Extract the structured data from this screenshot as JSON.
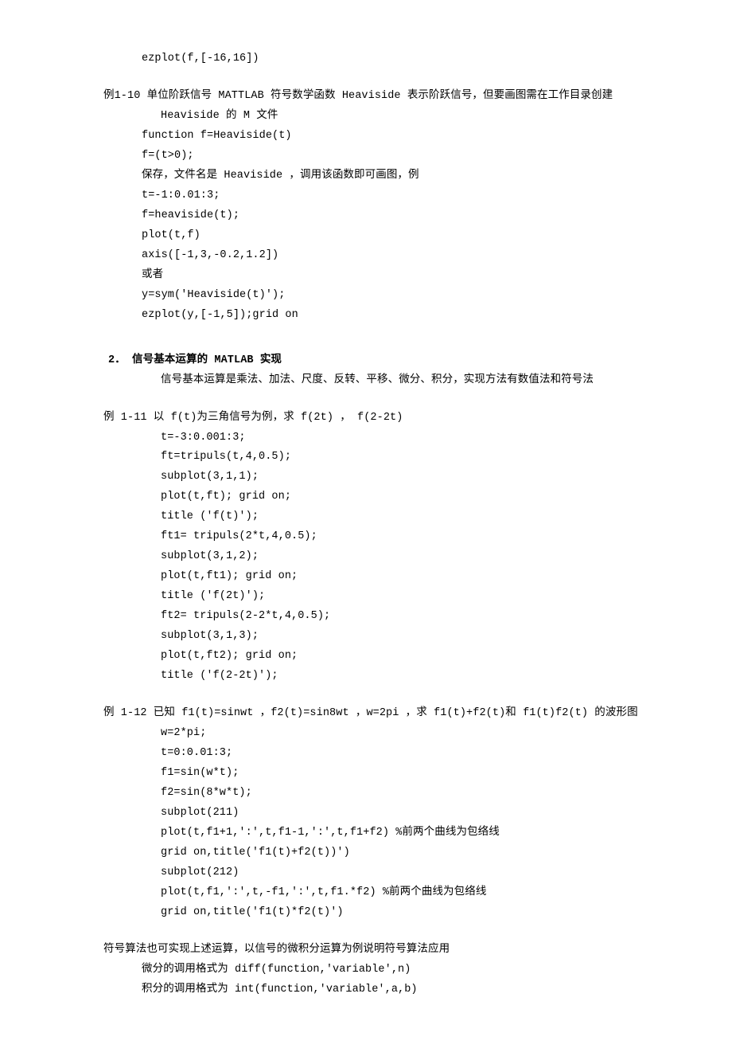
{
  "top_line": "ezplot(f,[-16,16])",
  "ex1_10": {
    "title": "例1-10  单位阶跃信号  MATTLAB 符号数学函数 Heaviside 表示阶跃信号，但要画图需在工作目录创建",
    "title2": "Heaviside 的 M 文件",
    "lines": [
      "function f=Heaviside(t)",
      "f=(t>0);",
      "保存，文件名是 Heaviside ，调用该函数即可画图，例",
      "t=-1:0.01:3;",
      "f=heaviside(t);",
      "plot(t,f)",
      "axis([-1,3,-0.2,1.2])",
      "或者",
      "y=sym('Heaviside(t)');",
      "ezplot(y,[-1,5]);grid on"
    ]
  },
  "sec2": {
    "heading": "2． 信号基本运算的 MATLAB 实现",
    "intro": "信号基本运算是乘法、加法、尺度、反转、平移、微分、积分，实现方法有数值法和符号法"
  },
  "ex1_11": {
    "title": "例 1-11  以 f(t)为三角信号为例，求 f(2t) ， f(2-2t)",
    "lines": [
      "t=-3:0.001:3;",
      "ft=tripuls(t,4,0.5);",
      "subplot(3,1,1);",
      "plot(t,ft);  grid on;",
      "title ('f(t)');",
      "ft1= tripuls(2*t,4,0.5);",
      " subplot(3,1,2);",
      "plot(t,ft1);  grid on;",
      "title ('f(2t)');",
      "ft2= tripuls(2-2*t,4,0.5);",
      " subplot(3,1,3);",
      "plot(t,ft2);  grid on;",
      "title ('f(2-2t)');"
    ]
  },
  "ex1_12": {
    "title": "例 1-12 已知 f1(t)=sinwt ，f2(t)=sin8wt ，w=2pi ，求 f1(t)+f2(t)和 f1(t)f2(t) 的波形图",
    "lines": [
      "w=2*pi;",
      "t=0:0.01:3;",
      "f1=sin(w*t);",
      "f2=sin(8*w*t);",
      "subplot(211)",
      "plot(t,f1+1,':',t,f1-1,':',t,f1+f2)  %前两个曲线为包络线",
      "grid on,title('f1(t)+f2(t))')",
      "subplot(212)",
      "plot(t,f1,':',t,-f1,':',t,f1.*f2) %前两个曲线为包络线",
      "grid on,title('f1(t)*f2(t)')"
    ]
  },
  "sym": {
    "title": "符号算法也可实现上述运算，以信号的微积分运算为例说明符号算法应用",
    "lines": [
      "微分的调用格式为 diff(function,'variable',n)",
      "积分的调用格式为 int(function,'variable',a,b)"
    ]
  }
}
